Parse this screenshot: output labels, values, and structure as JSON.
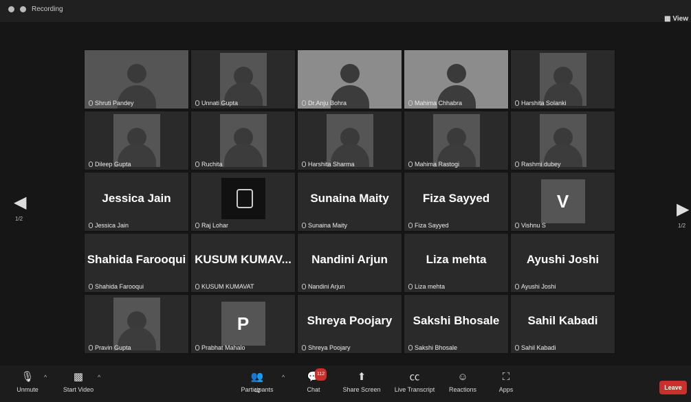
{
  "topbar": {
    "recording_label": "Recording",
    "view_label": "View"
  },
  "nav": {
    "left_page": "1/2",
    "right_page": "1/2"
  },
  "tiles": [
    {
      "name": "Shruti Pandey",
      "big": ""
    },
    {
      "name": "Unnati Gupta",
      "big": ""
    },
    {
      "name": "Dr.Anju Bohra",
      "big": ""
    },
    {
      "name": "Mahima Chhabra",
      "big": ""
    },
    {
      "name": "Harshita Solanki",
      "big": ""
    },
    {
      "name": "Dileep Gupta",
      "big": ""
    },
    {
      "name": "Ruchita",
      "big": ""
    },
    {
      "name": "Harshita Sharma",
      "big": ""
    },
    {
      "name": "Mahima Rastogi",
      "big": ""
    },
    {
      "name": "Rashmi dubey",
      "big": ""
    },
    {
      "name": "Jessica Jain",
      "big": "Jessica Jain"
    },
    {
      "name": "Raj Lohar",
      "big": ""
    },
    {
      "name": "Sunaina Maity",
      "big": "Sunaina Maity"
    },
    {
      "name": "Fiza Sayyed",
      "big": "Fiza Sayyed"
    },
    {
      "name": "Vishnu S",
      "big": "",
      "letter": "V"
    },
    {
      "name": "Shahida Farooqui",
      "big": "Shahida Farooqui"
    },
    {
      "name": "KUSUM KUMAVAT",
      "big": "KUSUM KUMAV..."
    },
    {
      "name": "Nandini Arjun",
      "big": "Nandini Arjun"
    },
    {
      "name": "Liza mehta",
      "big": "Liza mehta"
    },
    {
      "name": "Ayushi Joshi",
      "big": "Ayushi Joshi"
    },
    {
      "name": "Pravin Gupta",
      "big": ""
    },
    {
      "name": "Prabhat Mahalo",
      "big": "",
      "letter": "P"
    },
    {
      "name": "Shreya Poojary",
      "big": "Shreya Poojary"
    },
    {
      "name": "Sakshi Bhosale",
      "big": "Sakshi Bhosale"
    },
    {
      "name": "Sahil Kabadi",
      "big": "Sahil Kabadi"
    }
  ],
  "toolbar": {
    "unmute": "Unmute",
    "start_video": "Start Video",
    "participants": "Participants",
    "participants_count": "42",
    "chat": "Chat",
    "chat_badge": "112",
    "share_screen": "Share Screen",
    "live_transcript": "Live Transcript",
    "reactions": "Reactions",
    "apps": "Apps",
    "leave": "Leave"
  }
}
